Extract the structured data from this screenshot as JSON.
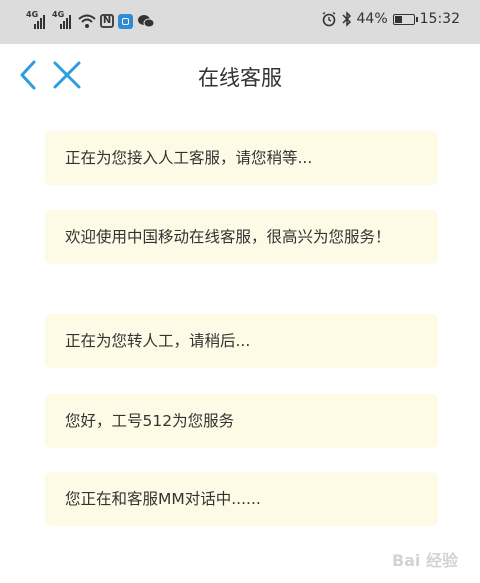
{
  "status_bar": {
    "network1": "4G",
    "network2": "4G",
    "battery_percent": "44%",
    "battery_level": 0.44,
    "time": "15:32",
    "icons": [
      "signal-icon",
      "signal-icon",
      "wifi-icon",
      "nfc-icon",
      "app-notification-icon",
      "wechat-icon",
      "alarm-icon",
      "bluetooth-icon",
      "battery-icon"
    ]
  },
  "header": {
    "title": "在线客服",
    "back_icon": "chevron-left-icon",
    "close_icon": "close-icon",
    "accent_color": "#2a9ee0"
  },
  "messages": [
    {
      "text": "正在为您接入人工客服，请您稍等..."
    },
    {
      "text": "欢迎使用中国移动在线客服，很高兴为您服务！"
    },
    {
      "text": "正在为您转人工，请稍后..."
    },
    {
      "text": "您好，工号512为您服务"
    },
    {
      "text": "您正在和客服MM对话中......"
    }
  ],
  "bubble_color": "#fdfbe6",
  "watermark": {
    "text": "Bai 经验"
  }
}
